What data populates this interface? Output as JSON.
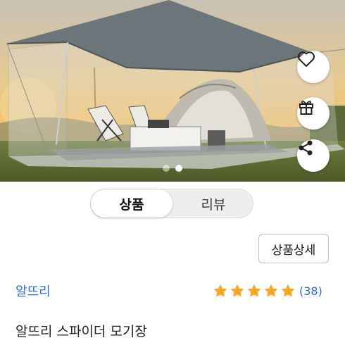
{
  "icons": {
    "like": "heart-outline-icon",
    "gift": "gift-icon",
    "share": "share-icon",
    "star": "star-icon"
  },
  "carousel": {
    "total": 2,
    "active": 2
  },
  "tabs": [
    {
      "label": "상품",
      "active": true
    },
    {
      "label": "리뷰",
      "active": false
    }
  ],
  "detail_button": "상품상세",
  "product": {
    "brand": "알뜨리",
    "rating": 5,
    "review_count": "(38)",
    "title": "알뜨리 스파이더 모기장"
  },
  "colors": {
    "brand_link": "#2f6dd6",
    "star": "#f5a623"
  }
}
